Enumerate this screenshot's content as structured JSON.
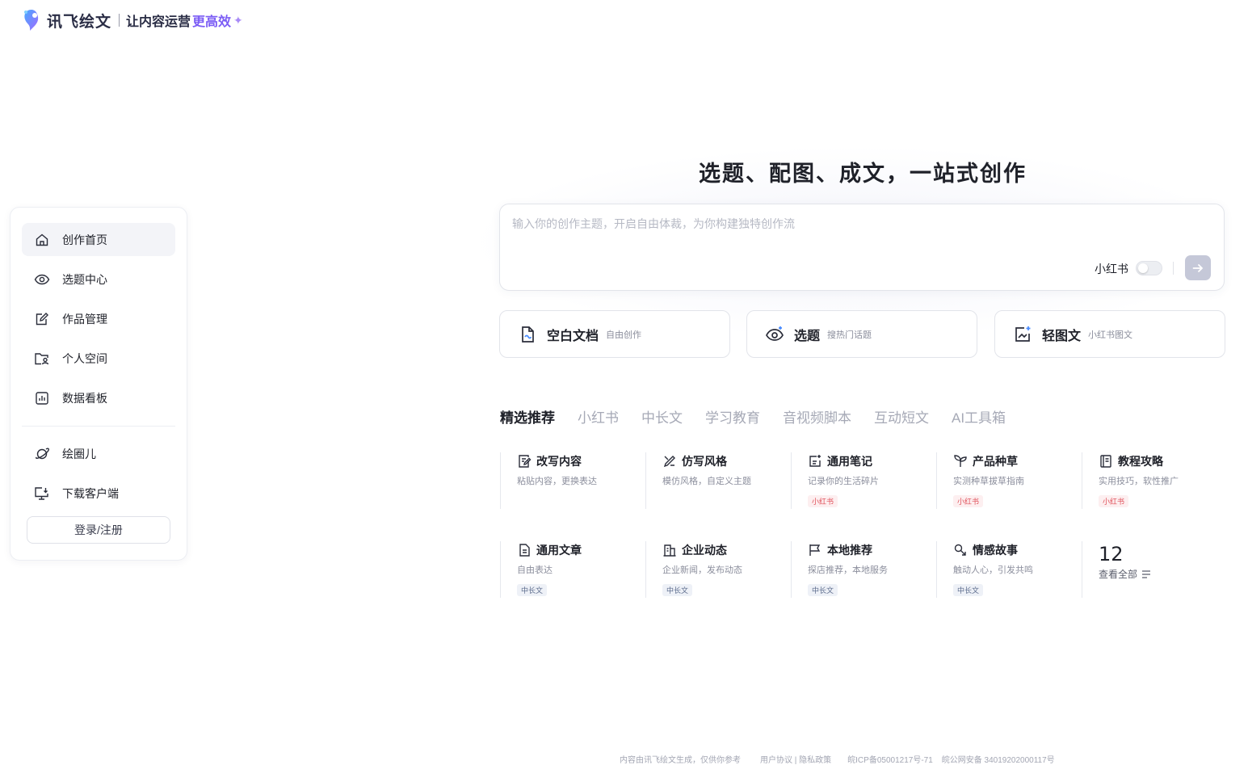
{
  "brand": {
    "name": "讯飞绘文",
    "slogan": "让内容运营",
    "slogan_highlight": "更高效",
    "accent": "#7b5cf5"
  },
  "sidebar": {
    "items": [
      {
        "label": "创作首页",
        "icon": "home-icon",
        "active": true
      },
      {
        "label": "选题中心",
        "icon": "eye-target-icon"
      },
      {
        "label": "作品管理",
        "icon": "edit-doc-icon"
      },
      {
        "label": "个人空间",
        "icon": "folder-user-icon"
      },
      {
        "label": "数据看板",
        "icon": "chart-board-icon"
      }
    ],
    "secondary": [
      {
        "label": "绘圈儿",
        "icon": "planet-icon"
      },
      {
        "label": "下载客户端",
        "icon": "monitor-download-icon"
      }
    ],
    "login_label": "登录/注册"
  },
  "main": {
    "title": "选题、配图、成文，一站式创作",
    "input": {
      "placeholder": "输入你的创作主题，开启自由体裁，为你构建独特创作流",
      "toggle_label": "小红书",
      "toggle_on": false
    },
    "quick_actions": [
      {
        "title": "空白文档",
        "sub": "自由创作",
        "icon": "blank-doc-icon"
      },
      {
        "title": "选题",
        "sub": "搜热门话题",
        "icon": "eye-sparkle-icon"
      },
      {
        "title": "轻图文",
        "sub": "小红书图文",
        "icon": "image-text-icon"
      }
    ],
    "tabs": [
      "精选推荐",
      "小红书",
      "中长文",
      "学习教育",
      "音视频脚本",
      "互动短文",
      "AI工具箱"
    ],
    "active_tab": 0,
    "templates": [
      {
        "title": "改写内容",
        "desc": "粘贴内容，更换表达",
        "tag": "",
        "icon": "rewrite-icon"
      },
      {
        "title": "仿写风格",
        "desc": "模仿风格，自定义主题",
        "tag": "",
        "icon": "style-brush-icon"
      },
      {
        "title": "通用笔记",
        "desc": "记录你的生活碎片",
        "tag": "小红书",
        "icon": "note-icon"
      },
      {
        "title": "产品种草",
        "desc": "实测种草拔草指南",
        "tag": "小红书",
        "icon": "sprout-icon"
      },
      {
        "title": "教程攻略",
        "desc": "实用技巧，软性推广",
        "tag": "小红书",
        "icon": "guide-book-icon"
      },
      {
        "title": "通用文章",
        "desc": "自由表达",
        "tag": "中长文",
        "icon": "article-icon"
      },
      {
        "title": "企业动态",
        "desc": "企业新闻，发布动态",
        "tag": "中长文",
        "icon": "building-icon"
      },
      {
        "title": "本地推荐",
        "desc": "探店推荐，本地服务",
        "tag": "中长文",
        "icon": "flag-icon"
      },
      {
        "title": "情感故事",
        "desc": "触动人心，引发共鸣",
        "tag": "中长文",
        "icon": "heart-story-icon"
      }
    ],
    "view_all": {
      "count": "12",
      "label": "查看全部"
    }
  },
  "footer": {
    "disclaimer": "内容由讯飞绘文生成，仅供你参考",
    "links": "用户协议 | 隐私政策",
    "icp": "皖ICP备05001217号-71",
    "police": "皖公网安备 34019202000117号"
  }
}
